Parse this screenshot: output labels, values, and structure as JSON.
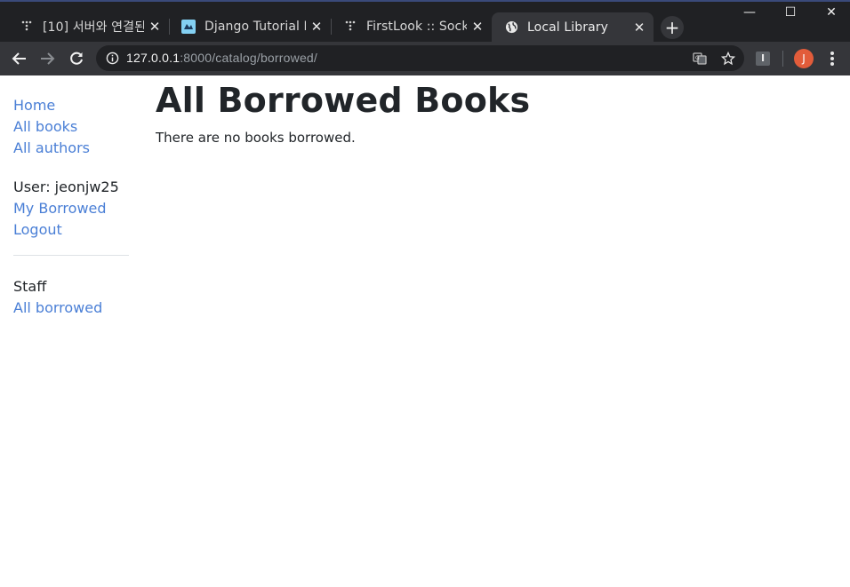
{
  "browser": {
    "tabs": [
      {
        "title": "[10] 서버와 연결된",
        "icon": "tumblr-like-icon",
        "active": false
      },
      {
        "title": "Django Tutorial Pa",
        "icon": "mdn-icon",
        "active": false
      },
      {
        "title": "FirstLook :: Socket",
        "icon": "tumblr-like-icon",
        "active": false
      },
      {
        "title": "Local Library",
        "icon": "globe-icon",
        "active": true
      }
    ],
    "close_glyph": "✕",
    "new_tab_glyph": "+",
    "window_controls": {
      "minimize": "—",
      "maximize": "☐",
      "close": "✕"
    },
    "url_host": "127.0.0.1",
    "url_rest": ":8000/catalog/borrowed/",
    "profile_initial": "J",
    "extension_label": "I",
    "colors": {
      "chrome_bg": "#202124",
      "toolbar_bg": "#35363a",
      "avatar": "#e25c3a",
      "link": "#4a7fd6"
    }
  },
  "sidebar": {
    "nav_links": [
      {
        "label": "Home"
      },
      {
        "label": "All books"
      },
      {
        "label": "All authors"
      }
    ],
    "user_label": "User: jeonjw25",
    "user_links": [
      {
        "label": "My Borrowed"
      },
      {
        "label": "Logout"
      }
    ],
    "staff_label": "Staff",
    "staff_links": [
      {
        "label": "All borrowed"
      }
    ]
  },
  "main": {
    "heading": "All Borrowed Books",
    "empty_message": "There are no books borrowed."
  }
}
